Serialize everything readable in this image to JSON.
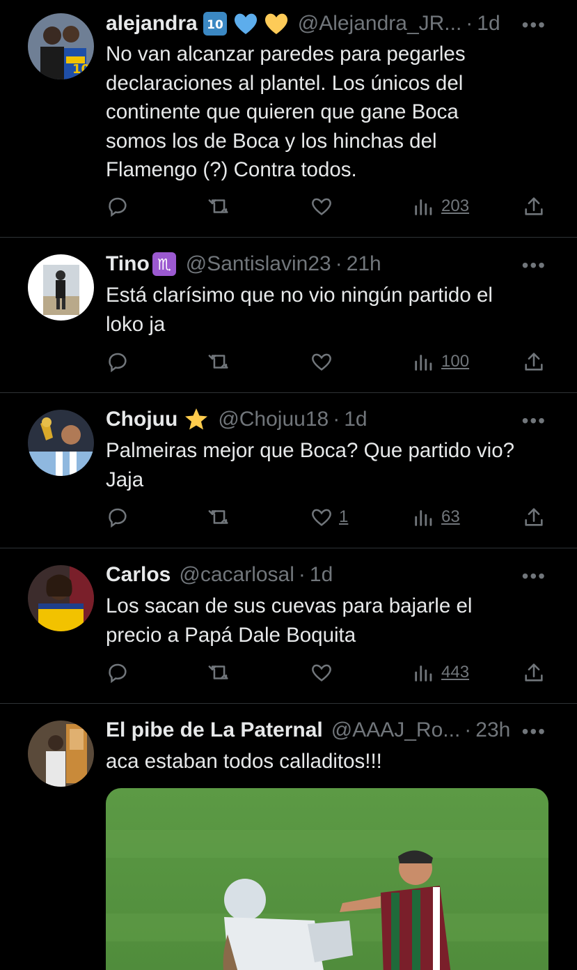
{
  "tweets": [
    {
      "name": "alejandra",
      "handle": "@Alejandra_JR...",
      "time": "1d",
      "text": "No van alcanzar paredes para pegarles\ndeclaraciones al plantel. Los únicos del\ncontinente que quieren que gane Boca\nsomos los de Boca y los hinchas del\nFlamengo (?) Contra todos.",
      "likes": "",
      "views": "203",
      "emojis": [
        "keycap-10-emoji",
        "blue-heart-emoji",
        "yellow-heart-emoji"
      ]
    },
    {
      "name": "Tino",
      "handle": "@Santislavin23",
      "time": "21h",
      "text": "Está clarísimo que no vio ningún partido el\nloko ja",
      "likes": "",
      "views": "100",
      "emojis": [
        "scorpio-emoji"
      ]
    },
    {
      "name": "Chojuu",
      "handle": "@Chojuu18",
      "time": "1d",
      "text": "Palmeiras mejor que Boca? Que partido vio?\nJaja",
      "likes": "1",
      "views": "63",
      "emojis": [
        "star-emoji"
      ]
    },
    {
      "name": "Carlos",
      "handle": "@cacarlosal",
      "time": "1d",
      "text": "Los sacan de sus cuevas para bajarle el\nprecio a Papá Dale Boquita",
      "likes": "",
      "views": "443",
      "emojis": []
    },
    {
      "name": "El pibe de La Paternal",
      "handle": "@AAAJ_Ro...",
      "time": "23h",
      "text": "aca estaban todos calladitos!!!",
      "likes": "",
      "views": "",
      "emojis": []
    }
  ],
  "separator": "·",
  "more_glyph": "•••",
  "icons": [
    "reply-icon",
    "retweet-icon",
    "like-icon",
    "views-icon",
    "share-icon",
    "more-icon"
  ],
  "colors": {
    "background": "#000000",
    "text": "#e7e9ea",
    "secondary": "#71767b",
    "divider": "#2f3336"
  }
}
